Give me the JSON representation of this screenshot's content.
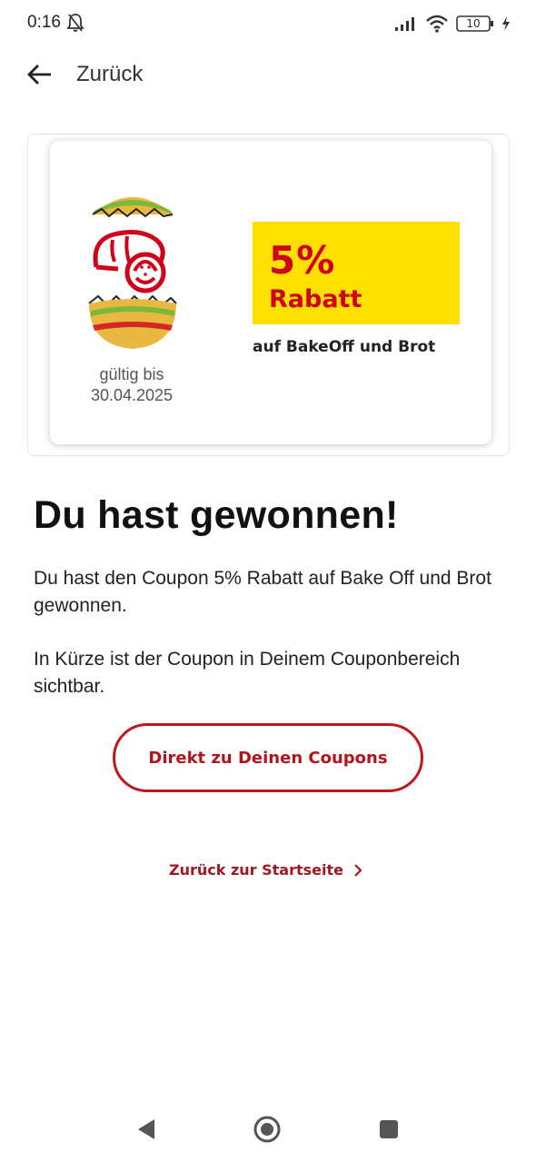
{
  "status_bar": {
    "time": "0:16",
    "battery_level": "10",
    "icons": [
      "bell-off-icon",
      "signal-icon",
      "wifi-icon",
      "battery-icon",
      "charging-icon"
    ]
  },
  "header": {
    "back_label": "Zurück"
  },
  "coupon": {
    "valid_label": "gültig bis",
    "valid_date": "30.04.2025",
    "discount_percent": "5%",
    "discount_label": "Rabatt",
    "discount_subtitle": "auf BakeOff und Brot",
    "colors": {
      "accent": "#ffe000",
      "text": "#d0021b"
    }
  },
  "content": {
    "heading": "Du hast gewonnen!",
    "paragraph_1": "Du hast den Coupon 5% Rabatt auf Bake Off und Brot gewonnen.",
    "paragraph_2": "In Kürze ist der Coupon in Deinem Couponbereich sichtbar."
  },
  "actions": {
    "coupons_button_label": "Direkt zu Deinen Coupons",
    "home_link_label": "Zurück zur Startseite"
  },
  "nav_bar": {
    "icons": [
      "nav-back-icon",
      "nav-home-icon",
      "nav-recents-icon"
    ]
  },
  "colors": {
    "brand_red": "#c0161c"
  }
}
